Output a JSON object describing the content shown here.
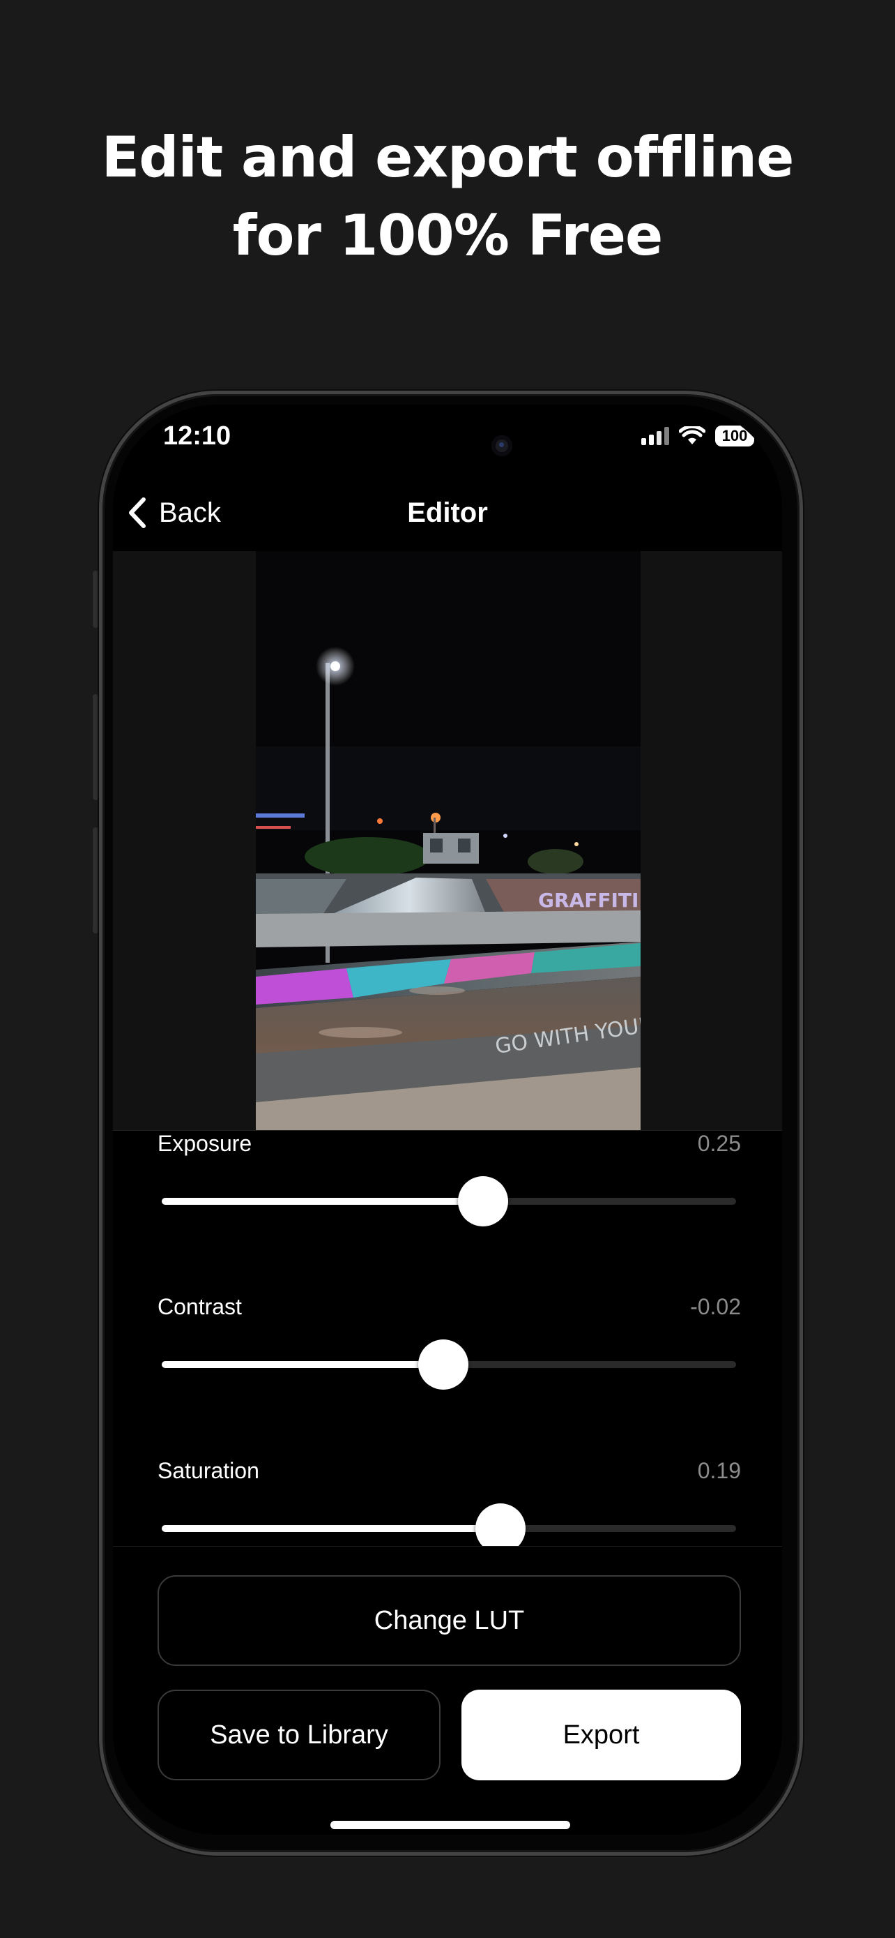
{
  "headline": {
    "line1": "Edit and export offline",
    "line2": "for 100% Free"
  },
  "status_bar": {
    "time": "12:10",
    "battery": "100",
    "icons": [
      "cellular-signal-icon",
      "wifi-icon",
      "battery-icon"
    ]
  },
  "nav": {
    "back_label": "Back",
    "title": "Editor"
  },
  "adjustments": [
    {
      "label": "Exposure",
      "value": "0.25",
      "position": 0.56
    },
    {
      "label": "Contrast",
      "value": "-0.02",
      "position": 0.49
    },
    {
      "label": "Saturation",
      "value": "0.19",
      "position": 0.59
    }
  ],
  "actions": {
    "change_lut": "Change LUT",
    "save_to_library": "Save to Library",
    "export": "Export"
  },
  "photo": {
    "graffiti_text": "GO WITH YOUR"
  },
  "colors": {
    "background": "#1a1a1a",
    "screen": "#000000",
    "accent": "#ffffff",
    "muted_text": "#8c8c8c"
  }
}
